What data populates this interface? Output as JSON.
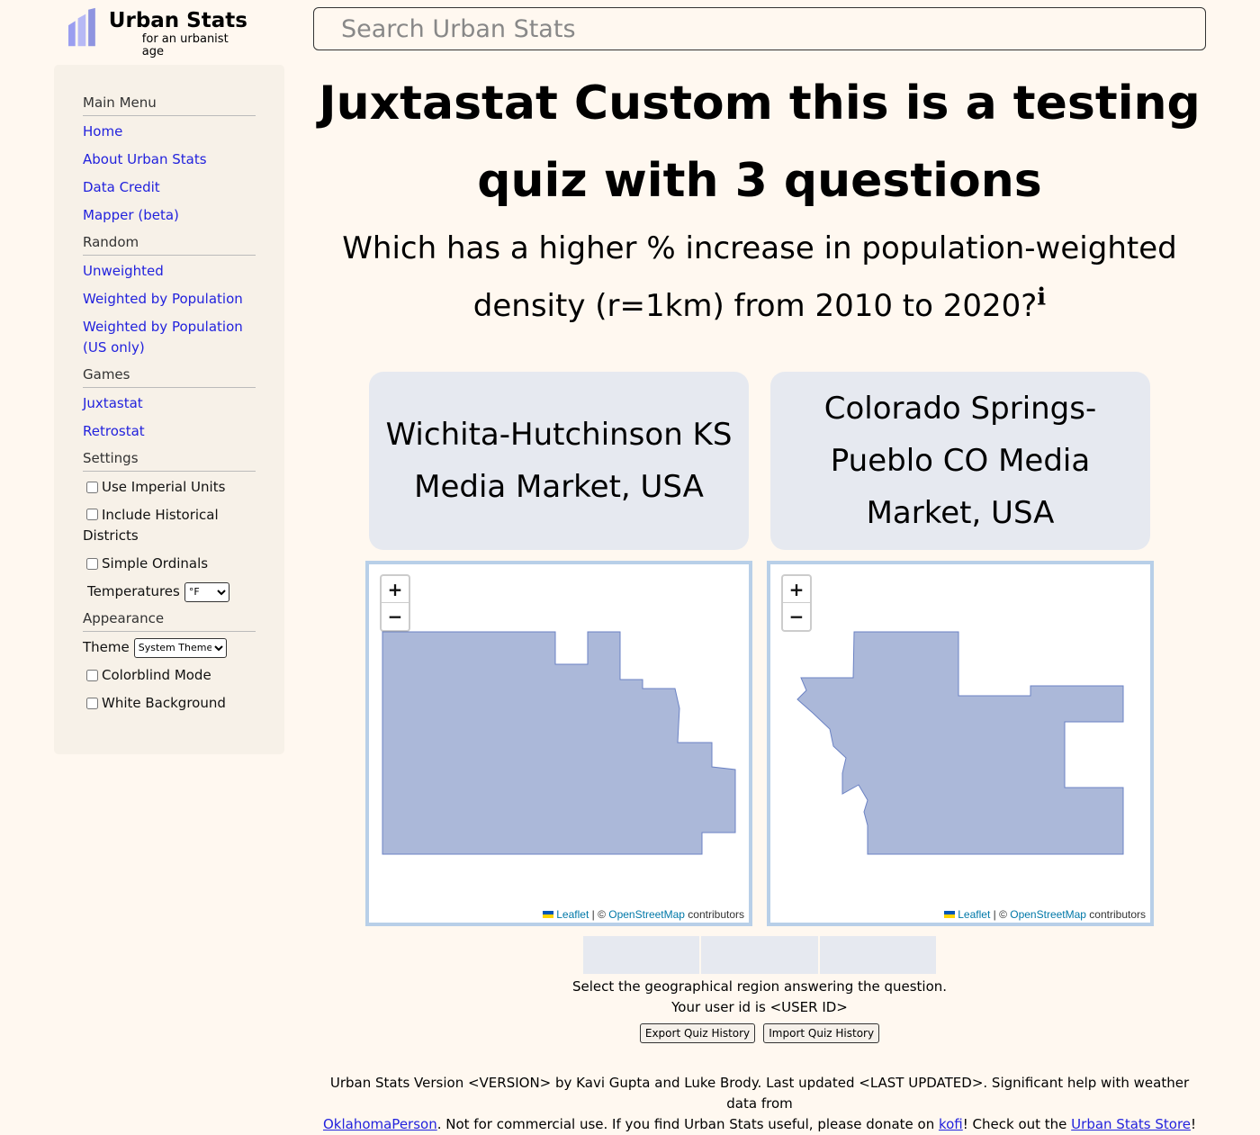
{
  "header": {
    "logo_title": "Urban Stats",
    "logo_tagline": "for an urbanist age",
    "search_placeholder": "Search Urban Stats"
  },
  "sidebar": {
    "main_menu": {
      "heading": "Main Menu",
      "items": [
        "Home",
        "About Urban Stats",
        "Data Credit",
        "Mapper (beta)"
      ]
    },
    "random": {
      "heading": "Random",
      "items": [
        "Unweighted",
        "Weighted by Population",
        "Weighted by Population (US only)"
      ]
    },
    "games": {
      "heading": "Games",
      "items": [
        "Juxtastat",
        "Retrostat"
      ]
    },
    "settings": {
      "heading": "Settings",
      "use_imperial": "Use Imperial Units",
      "include_historical": "Include Historical Districts",
      "simple_ordinals": "Simple Ordinals",
      "temperatures_label": "Temperatures",
      "temperature_value": "°F"
    },
    "appearance": {
      "heading": "Appearance",
      "theme_label": "Theme",
      "theme_value": "System Theme",
      "colorblind": "Colorblind Mode",
      "white_background": "White Background"
    }
  },
  "quiz": {
    "title": "Juxtastat Custom this is a testing quiz with 3 questions",
    "question": "Which has a higher % increase in population-weighted density (r=1km) from 2010 to 2020?",
    "info_marker": "i",
    "choice_a": "Wichita-Hutchinson KS Media Market, USA",
    "choice_b": "Colorado Springs-Pueblo CO Media Market, USA",
    "instruction": "Select the geographical region answering the question.",
    "user_id_line": "Your user id is <USER ID>",
    "export_button": "Export Quiz History",
    "import_button": "Import Quiz History",
    "progress_total": 3,
    "progress_answered": 0
  },
  "map": {
    "zoom_in": "+",
    "zoom_out": "−",
    "attr_leaflet": "Leaflet",
    "attr_sep": " | © ",
    "attr_osm": "OpenStreetMap",
    "attr_suffix": " contributors",
    "region_fill": "#abb8d9",
    "region_stroke": "#6b82c4"
  },
  "footer": {
    "line1": "Urban Stats Version <VERSION> by Kavi Gupta and Luke Brody. Last updated <LAST UPDATED>. Significant help with weather data from",
    "link_oklahoma": "OklahomaPerson",
    "text2": ". Not for commercial use. If you find Urban Stats useful, please donate on ",
    "link_kofi": "kofi",
    "text3": "! Check out the ",
    "link_store": "Urban Stats Store",
    "text4": "!"
  },
  "colors": {
    "background": "#fff8f0",
    "sidebar": "#f7f1e8",
    "link": "#2222dd",
    "choice_bg": "#e6e9f0",
    "map_border": "#b8cfe8"
  }
}
